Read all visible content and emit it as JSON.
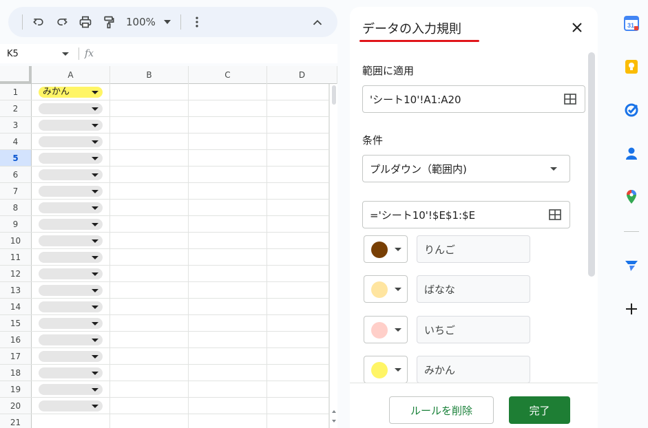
{
  "toolbar": {
    "zoom": "100%"
  },
  "formula_bar": {
    "cell_ref": "K5",
    "fx": "fx",
    "value": ""
  },
  "grid": {
    "columns": [
      "A",
      "B",
      "C",
      "D"
    ],
    "rows": [
      {
        "num": "1",
        "value": "みかん"
      },
      {
        "num": "2",
        "value": ""
      },
      {
        "num": "3",
        "value": ""
      },
      {
        "num": "4",
        "value": ""
      },
      {
        "num": "5",
        "value": ""
      },
      {
        "num": "6",
        "value": ""
      },
      {
        "num": "7",
        "value": ""
      },
      {
        "num": "8",
        "value": ""
      },
      {
        "num": "9",
        "value": ""
      },
      {
        "num": "10",
        "value": ""
      },
      {
        "num": "11",
        "value": ""
      },
      {
        "num": "12",
        "value": ""
      },
      {
        "num": "13",
        "value": ""
      },
      {
        "num": "14",
        "value": ""
      },
      {
        "num": "15",
        "value": ""
      },
      {
        "num": "16",
        "value": ""
      },
      {
        "num": "17",
        "value": ""
      },
      {
        "num": "18",
        "value": ""
      },
      {
        "num": "19",
        "value": ""
      },
      {
        "num": "20",
        "value": ""
      },
      {
        "num": "21",
        "value": ""
      }
    ],
    "selected_row": "5",
    "chip_color": "#fff566"
  },
  "panel": {
    "title": "データの入力規則",
    "range_label": "範囲に適用",
    "range_value": "'シート10'!A1:A20",
    "criteria_label": "条件",
    "criteria_value": "プルダウン（範囲内)",
    "source_value": "='シート10'!$E$1:$E",
    "options": [
      {
        "label": "りんご",
        "color": "#783f04"
      },
      {
        "label": "ばなな",
        "color": "#ffe5a0"
      },
      {
        "label": "いちご",
        "color": "#ffcfc9"
      },
      {
        "label": "みかん",
        "color": "#fff566"
      }
    ],
    "delete_button": "ルールを削除",
    "done_button": "完了"
  },
  "rail": {
    "calendar_day": "31"
  }
}
